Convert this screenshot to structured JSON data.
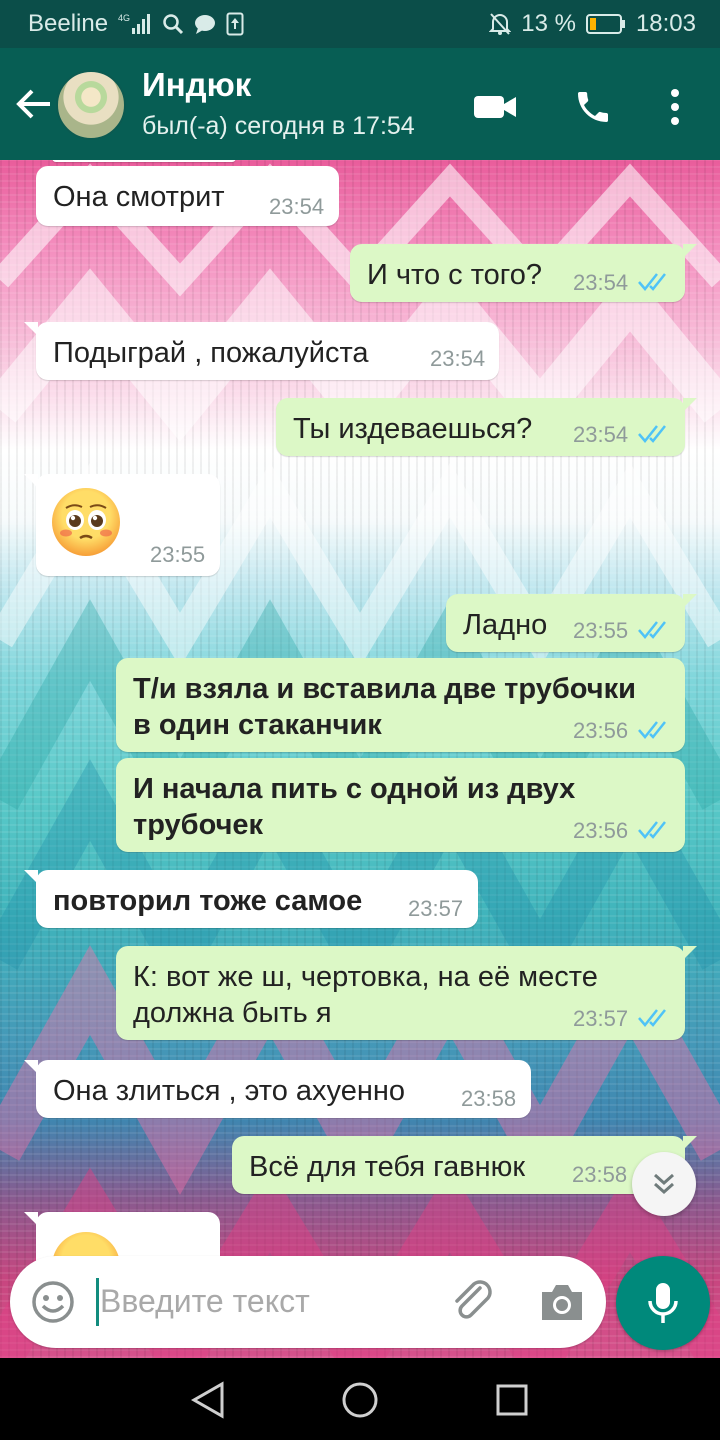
{
  "status_bar": {
    "carrier": "Beeline",
    "network": "4G",
    "battery": "13 %",
    "time": "18:03"
  },
  "header": {
    "contact_name": "Индюк",
    "last_seen": "был(-а) сегодня в 17:54",
    "icons": [
      "back-arrow-icon",
      "video-call-icon",
      "phone-icon",
      "more-vert-icon"
    ]
  },
  "messages": [
    {
      "dir": "in",
      "text": "Она смотрит",
      "time": "23:54"
    },
    {
      "dir": "out",
      "text": "И что с того?",
      "time": "23:54",
      "read": true
    },
    {
      "dir": "in",
      "text": "Подыграй , пожалуйста",
      "time": "23:54"
    },
    {
      "dir": "out",
      "text": "Ты издеваешься?",
      "time": "23:54",
      "read": true
    },
    {
      "dir": "in",
      "emoji": "pleading-face",
      "time": "23:55"
    },
    {
      "dir": "out",
      "text": "Ладно",
      "time": "23:55",
      "read": true
    },
    {
      "dir": "out",
      "bold": true,
      "lines": [
        "Т/и взяла и вставила две трубочки",
        "в один стаканчик"
      ],
      "time": "23:56",
      "read": true
    },
    {
      "dir": "out",
      "bold": true,
      "lines": [
        "И начала пить с одной из двух",
        "трубочек"
      ],
      "time": "23:56",
      "read": true
    },
    {
      "dir": "in",
      "bold": true,
      "text": "повторил тоже самое",
      "time": "23:57"
    },
    {
      "dir": "out",
      "lines": [
        "К: вот же ш, чертовка, на её месте",
        "должна быть я"
      ],
      "time": "23:57",
      "read": true
    },
    {
      "dir": "in",
      "text": "Она злиться , это ахуенно",
      "time": "23:58"
    },
    {
      "dir": "out",
      "text": "Всё для тебя гавнюк",
      "time": "23:58",
      "read": true
    },
    {
      "dir": "in",
      "emoji": "partial-emoji"
    }
  ],
  "input": {
    "placeholder": "Введите текст"
  },
  "colors": {
    "header": "#075e54",
    "outgoing_bubble": "#dcf8c6",
    "incoming_bubble": "#ffffff",
    "read_ticks": "#4fc3f7",
    "mic_button": "#00897b"
  }
}
